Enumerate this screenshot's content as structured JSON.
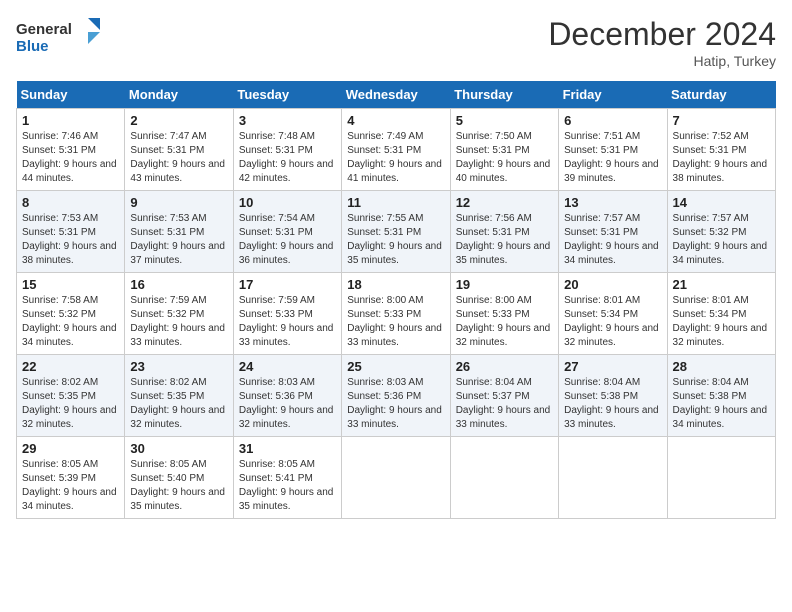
{
  "header": {
    "logo_line1": "General",
    "logo_line2": "Blue",
    "month": "December 2024",
    "location": "Hatip, Turkey"
  },
  "weekdays": [
    "Sunday",
    "Monday",
    "Tuesday",
    "Wednesday",
    "Thursday",
    "Friday",
    "Saturday"
  ],
  "weeks": [
    [
      {
        "day": "1",
        "sunrise": "Sunrise: 7:46 AM",
        "sunset": "Sunset: 5:31 PM",
        "daylight": "Daylight: 9 hours and 44 minutes."
      },
      {
        "day": "2",
        "sunrise": "Sunrise: 7:47 AM",
        "sunset": "Sunset: 5:31 PM",
        "daylight": "Daylight: 9 hours and 43 minutes."
      },
      {
        "day": "3",
        "sunrise": "Sunrise: 7:48 AM",
        "sunset": "Sunset: 5:31 PM",
        "daylight": "Daylight: 9 hours and 42 minutes."
      },
      {
        "day": "4",
        "sunrise": "Sunrise: 7:49 AM",
        "sunset": "Sunset: 5:31 PM",
        "daylight": "Daylight: 9 hours and 41 minutes."
      },
      {
        "day": "5",
        "sunrise": "Sunrise: 7:50 AM",
        "sunset": "Sunset: 5:31 PM",
        "daylight": "Daylight: 9 hours and 40 minutes."
      },
      {
        "day": "6",
        "sunrise": "Sunrise: 7:51 AM",
        "sunset": "Sunset: 5:31 PM",
        "daylight": "Daylight: 9 hours and 39 minutes."
      },
      {
        "day": "7",
        "sunrise": "Sunrise: 7:52 AM",
        "sunset": "Sunset: 5:31 PM",
        "daylight": "Daylight: 9 hours and 38 minutes."
      }
    ],
    [
      {
        "day": "8",
        "sunrise": "Sunrise: 7:53 AM",
        "sunset": "Sunset: 5:31 PM",
        "daylight": "Daylight: 9 hours and 38 minutes."
      },
      {
        "day": "9",
        "sunrise": "Sunrise: 7:53 AM",
        "sunset": "Sunset: 5:31 PM",
        "daylight": "Daylight: 9 hours and 37 minutes."
      },
      {
        "day": "10",
        "sunrise": "Sunrise: 7:54 AM",
        "sunset": "Sunset: 5:31 PM",
        "daylight": "Daylight: 9 hours and 36 minutes."
      },
      {
        "day": "11",
        "sunrise": "Sunrise: 7:55 AM",
        "sunset": "Sunset: 5:31 PM",
        "daylight": "Daylight: 9 hours and 35 minutes."
      },
      {
        "day": "12",
        "sunrise": "Sunrise: 7:56 AM",
        "sunset": "Sunset: 5:31 PM",
        "daylight": "Daylight: 9 hours and 35 minutes."
      },
      {
        "day": "13",
        "sunrise": "Sunrise: 7:57 AM",
        "sunset": "Sunset: 5:31 PM",
        "daylight": "Daylight: 9 hours and 34 minutes."
      },
      {
        "day": "14",
        "sunrise": "Sunrise: 7:57 AM",
        "sunset": "Sunset: 5:32 PM",
        "daylight": "Daylight: 9 hours and 34 minutes."
      }
    ],
    [
      {
        "day": "15",
        "sunrise": "Sunrise: 7:58 AM",
        "sunset": "Sunset: 5:32 PM",
        "daylight": "Daylight: 9 hours and 34 minutes."
      },
      {
        "day": "16",
        "sunrise": "Sunrise: 7:59 AM",
        "sunset": "Sunset: 5:32 PM",
        "daylight": "Daylight: 9 hours and 33 minutes."
      },
      {
        "day": "17",
        "sunrise": "Sunrise: 7:59 AM",
        "sunset": "Sunset: 5:33 PM",
        "daylight": "Daylight: 9 hours and 33 minutes."
      },
      {
        "day": "18",
        "sunrise": "Sunrise: 8:00 AM",
        "sunset": "Sunset: 5:33 PM",
        "daylight": "Daylight: 9 hours and 33 minutes."
      },
      {
        "day": "19",
        "sunrise": "Sunrise: 8:00 AM",
        "sunset": "Sunset: 5:33 PM",
        "daylight": "Daylight: 9 hours and 32 minutes."
      },
      {
        "day": "20",
        "sunrise": "Sunrise: 8:01 AM",
        "sunset": "Sunset: 5:34 PM",
        "daylight": "Daylight: 9 hours and 32 minutes."
      },
      {
        "day": "21",
        "sunrise": "Sunrise: 8:01 AM",
        "sunset": "Sunset: 5:34 PM",
        "daylight": "Daylight: 9 hours and 32 minutes."
      }
    ],
    [
      {
        "day": "22",
        "sunrise": "Sunrise: 8:02 AM",
        "sunset": "Sunset: 5:35 PM",
        "daylight": "Daylight: 9 hours and 32 minutes."
      },
      {
        "day": "23",
        "sunrise": "Sunrise: 8:02 AM",
        "sunset": "Sunset: 5:35 PM",
        "daylight": "Daylight: 9 hours and 32 minutes."
      },
      {
        "day": "24",
        "sunrise": "Sunrise: 8:03 AM",
        "sunset": "Sunset: 5:36 PM",
        "daylight": "Daylight: 9 hours and 32 minutes."
      },
      {
        "day": "25",
        "sunrise": "Sunrise: 8:03 AM",
        "sunset": "Sunset: 5:36 PM",
        "daylight": "Daylight: 9 hours and 33 minutes."
      },
      {
        "day": "26",
        "sunrise": "Sunrise: 8:04 AM",
        "sunset": "Sunset: 5:37 PM",
        "daylight": "Daylight: 9 hours and 33 minutes."
      },
      {
        "day": "27",
        "sunrise": "Sunrise: 8:04 AM",
        "sunset": "Sunset: 5:38 PM",
        "daylight": "Daylight: 9 hours and 33 minutes."
      },
      {
        "day": "28",
        "sunrise": "Sunrise: 8:04 AM",
        "sunset": "Sunset: 5:38 PM",
        "daylight": "Daylight: 9 hours and 34 minutes."
      }
    ],
    [
      {
        "day": "29",
        "sunrise": "Sunrise: 8:05 AM",
        "sunset": "Sunset: 5:39 PM",
        "daylight": "Daylight: 9 hours and 34 minutes."
      },
      {
        "day": "30",
        "sunrise": "Sunrise: 8:05 AM",
        "sunset": "Sunset: 5:40 PM",
        "daylight": "Daylight: 9 hours and 35 minutes."
      },
      {
        "day": "31",
        "sunrise": "Sunrise: 8:05 AM",
        "sunset": "Sunset: 5:41 PM",
        "daylight": "Daylight: 9 hours and 35 minutes."
      },
      null,
      null,
      null,
      null
    ]
  ]
}
